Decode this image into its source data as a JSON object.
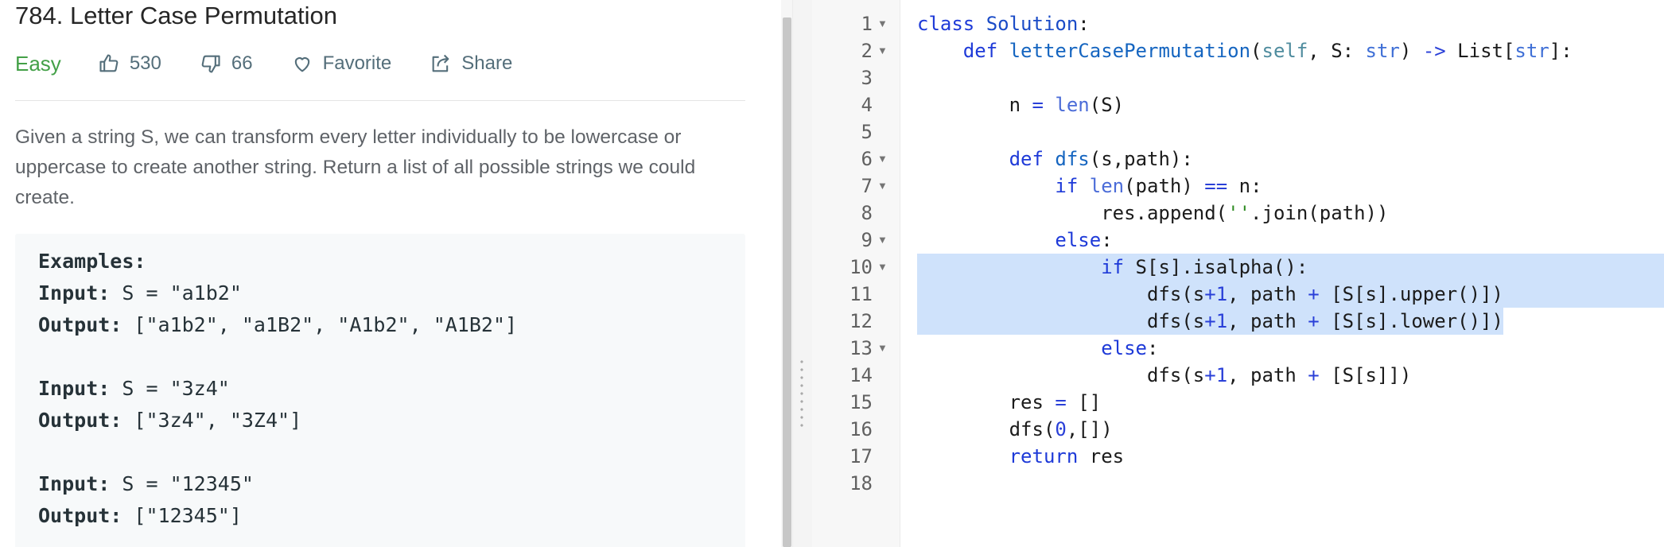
{
  "problem": {
    "title": "784. Letter Case Permutation",
    "difficulty": "Easy",
    "likes": "530",
    "dislikes": "66",
    "favorite_label": "Favorite",
    "share_label": "Share",
    "description": "Given a string S, we can transform every letter individually to be lowercase or uppercase to create another string.  Return a list of all possible strings we could create.",
    "examples_heading": "Examples:",
    "examples": [
      {
        "input_label": "Input:",
        "input": " S = \"a1b2\"",
        "output_label": "Output:",
        "output": " [\"a1b2\", \"a1B2\", \"A1b2\", \"A1B2\"]"
      },
      {
        "input_label": "Input:",
        "input": " S = \"3z4\"",
        "output_label": "Output:",
        "output": " [\"3z4\", \"3Z4\"]"
      },
      {
        "input_label": "Input:",
        "input": " S = \"12345\"",
        "output_label": "Output:",
        "output": " [\"12345\"]"
      }
    ]
  },
  "editor": {
    "line_numbers": [
      "1",
      "2",
      "3",
      "4",
      "5",
      "6",
      "7",
      "8",
      "9",
      "10",
      "11",
      "12",
      "13",
      "14",
      "15",
      "16",
      "17",
      "18"
    ],
    "folds": [
      "1",
      "2",
      "6",
      "7",
      "9",
      "10",
      "13"
    ],
    "highlighted_lines": [
      "10",
      "11",
      "12"
    ],
    "lines": [
      "class Solution:",
      "    def letterCasePermutation(self, S: str) -> List[str]:",
      "",
      "        n = len(S)",
      "",
      "        def dfs(s,path):",
      "            if len(path) == n:",
      "                res.append(''.join(path))",
      "            else:",
      "                if S[s].isalpha():",
      "                    dfs(s+1, path + [S[s].upper()])",
      "                    dfs(s+1, path + [S[s].lower()])",
      "                else:",
      "                    dfs(s+1, path + [S[s]])",
      "        res = []",
      "        dfs(0,[])",
      "        return res",
      ""
    ]
  },
  "colors": {
    "easy": "#43a047",
    "selection": "#cfe2fb",
    "keyword": "#1e3ad8",
    "string": "#2e8b22"
  }
}
